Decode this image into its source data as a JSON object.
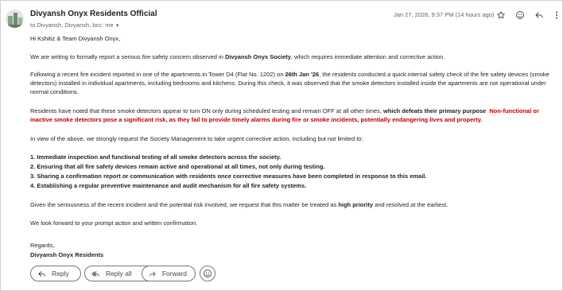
{
  "header": {
    "sender": "Divyansh Onyx Residents Official",
    "recipients": "to Divyansh, Divyansh, bcc: me",
    "date": "Jan 27, 2026, 9:37 PM (14 hours ago)",
    "icons": [
      "star-icon",
      "emoji-icon",
      "reply-icon",
      "more-vert-icon"
    ]
  },
  "body": {
    "greeting": "Hi Kshitiz & Team Divyansh Onyx,",
    "p1_a": "We are writing to formally report a serious fire safety concern observed in ",
    "p1_b": "Divyansh Onyx Society",
    "p1_c": ", which requires immediate attention and corrective action.",
    "p2_a": "Following a recent fire incident reported in one of the apartments in Tower D4 (Flat No. 1202) on ",
    "p2_b": "26th Jan '26",
    "p2_c": ", the residents conducted a quick internal safety check of the fire safety devices (smoke detectors) installed in individual apartments, including bedrooms and kitchens. During this check, it was observed that the smoke detectors installed inside the apartments are not operational under normal conditions.",
    "p3_a": "Residents have noted that these smoke detectors appear to turn ON only during scheduled testing and remain OFF at all other times, ",
    "p3_b": "which defeats their primary purpose",
    "p3_c": "Non-functional or inactive smoke detectors pose a significant risk, as they fail to provide timely alarms during fire or smoke incidents, potentially endangering lives and property.",
    "p4": "In view of the above, we strongly request the Society Management to take urgent corrective action, including but not limited to:",
    "list": [
      "1. Immediate inspection and functional testing of all smoke detectors across the society.",
      "2. Ensuring that all fire safety devices remain active and operational at all times, not only during testing.",
      "3. Sharing a confirmation report or communication with residents once corrective measures have been completed in response to this email.",
      "4. Establishing a regular preventive maintenance and audit mechanism for all fire safety systems."
    ],
    "p5_a": "Given the seriousness of the recent incident and the potential risk involved, we request that this matter be treated as ",
    "p5_b": "high priority",
    "p5_c": " and resolved at the earliest.",
    "p6": "We look forward to your prompt action and written confirmation.",
    "regards": "Regards,",
    "signature": "Divyansh Onyx Residents"
  },
  "actions": {
    "reply": "Reply",
    "reply_all": "Reply all",
    "forward": "Forward"
  },
  "colors": {
    "alert_red": "#c00000",
    "muted": "#5f6368"
  }
}
